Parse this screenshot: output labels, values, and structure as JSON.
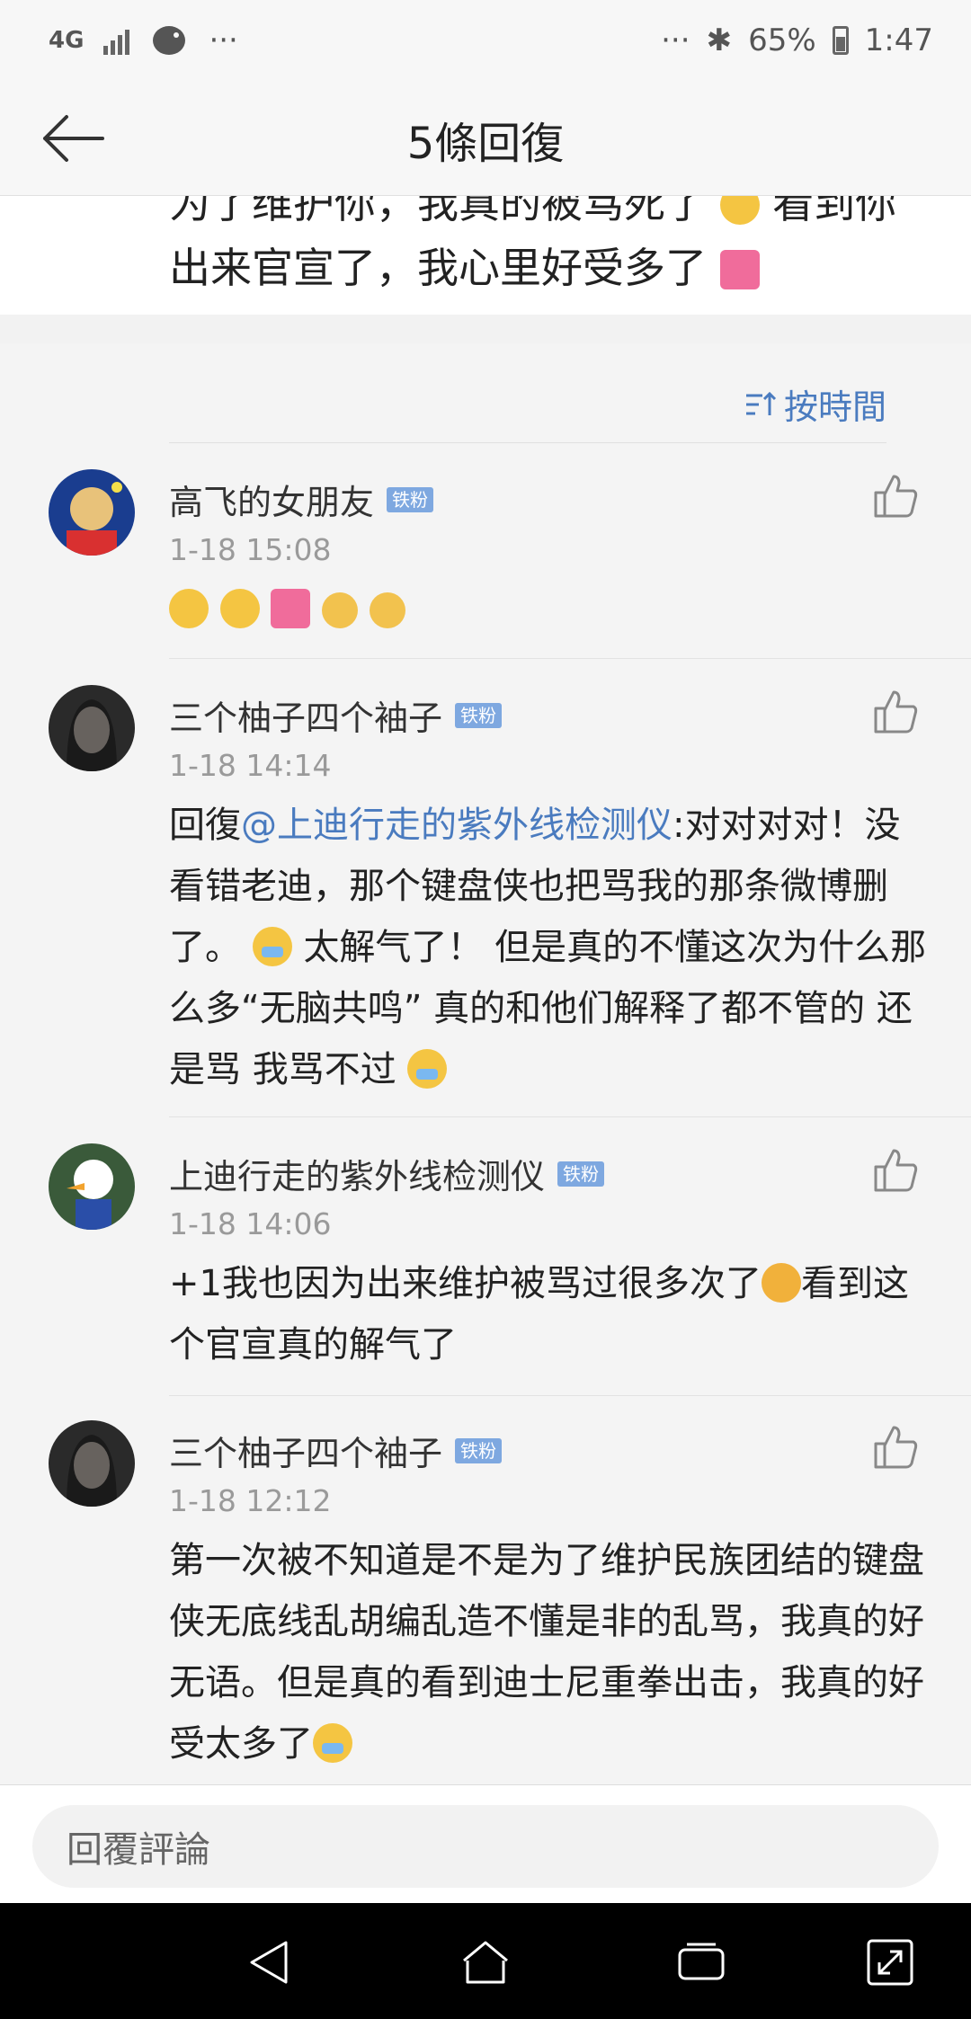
{
  "status": {
    "network": "4G",
    "dots_left": "···",
    "dots_right": "···",
    "battery": "65%",
    "time": "1:47"
  },
  "nav": {
    "title": "5條回復"
  },
  "original_post": {
    "line1": "为了维护你，我真的被骂死了",
    "line1_end": "看到你",
    "line2": "出来官宣了，我心里好受多了"
  },
  "sort": {
    "label": "按時間"
  },
  "comments": [
    {
      "name": "高飞的女朋友",
      "badge": "铁粉",
      "time": "1-18 15:08",
      "text": ""
    },
    {
      "name": "三个柚子四个袖子",
      "badge": "铁粉",
      "time": "1-18 14:14",
      "reply_prefix": "回復",
      "mention": "@上迪行走的紫外线检测仪",
      "text_a": ":对对对对！没看错老迪，那个键盘侠也把骂我的那条微博删了。",
      "text_b": "太解气了！ 但是真的不懂这次为什么那么多“无脑共鸣” 真的和他们解释了都不管的 还是骂 我骂不过"
    },
    {
      "name": "上迪行走的紫外线检测仪",
      "badge": "铁粉",
      "time": "1-18 14:06",
      "text_a": "+1我也因为出来维护被骂过很多次了",
      "text_b": "看到这个官宣真的解气了"
    },
    {
      "name": "三个柚子四个袖子",
      "badge": "铁粉",
      "time": "1-18 12:12",
      "text": "第一次被不知道是不是为了维护民族团结的键盘侠无底线乱胡编乱造不懂是非的乱骂，我真的好无语。但是真的看到迪士尼重拳出击，我真的好受太多了"
    }
  ],
  "reply_bar": {
    "placeholder": "回覆評論"
  },
  "colors": {
    "link": "#4a7bbf",
    "badge": "#7ea8e0"
  }
}
